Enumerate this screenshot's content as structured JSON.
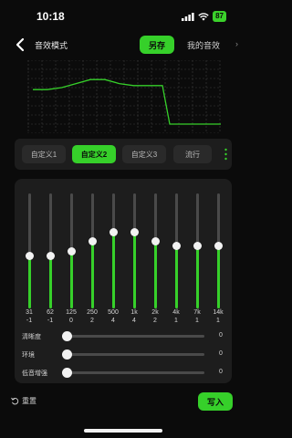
{
  "status_bar": {
    "time": "10:18",
    "battery": "87",
    "icons": [
      "signal-icon",
      "wifi-icon",
      "battery-icon"
    ]
  },
  "header": {
    "title": "音效模式",
    "save_as": "另存",
    "my_sound": "我的音效"
  },
  "presets": [
    {
      "label": "自定义1",
      "active": false
    },
    {
      "label": "自定义2",
      "active": true
    },
    {
      "label": "自定义3",
      "active": false
    },
    {
      "label": "流行",
      "active": false
    }
  ],
  "eq": {
    "range": [
      -12,
      12
    ],
    "bands": [
      {
        "freq": "31",
        "gain": "-1"
      },
      {
        "freq": "62",
        "gain": "-1"
      },
      {
        "freq": "125",
        "gain": "0"
      },
      {
        "freq": "250",
        "gain": "2"
      },
      {
        "freq": "500",
        "gain": "4"
      },
      {
        "freq": "1k",
        "gain": "4"
      },
      {
        "freq": "2k",
        "gain": "2"
      },
      {
        "freq": "4k",
        "gain": "1"
      },
      {
        "freq": "7k",
        "gain": "1"
      },
      {
        "freq": "14k",
        "gain": "1"
      }
    ]
  },
  "sliders": [
    {
      "label": "清晰度",
      "value": "0",
      "level": 0
    },
    {
      "label": "环境",
      "value": "0",
      "level": 0
    },
    {
      "label": "低音增强",
      "value": "0",
      "level": 0
    }
  ],
  "footer": {
    "reset": "重置",
    "write": "写入"
  },
  "colors": {
    "accent": "#36d02a",
    "background": "#0b0b0b",
    "panel": "#1d1d1d"
  }
}
